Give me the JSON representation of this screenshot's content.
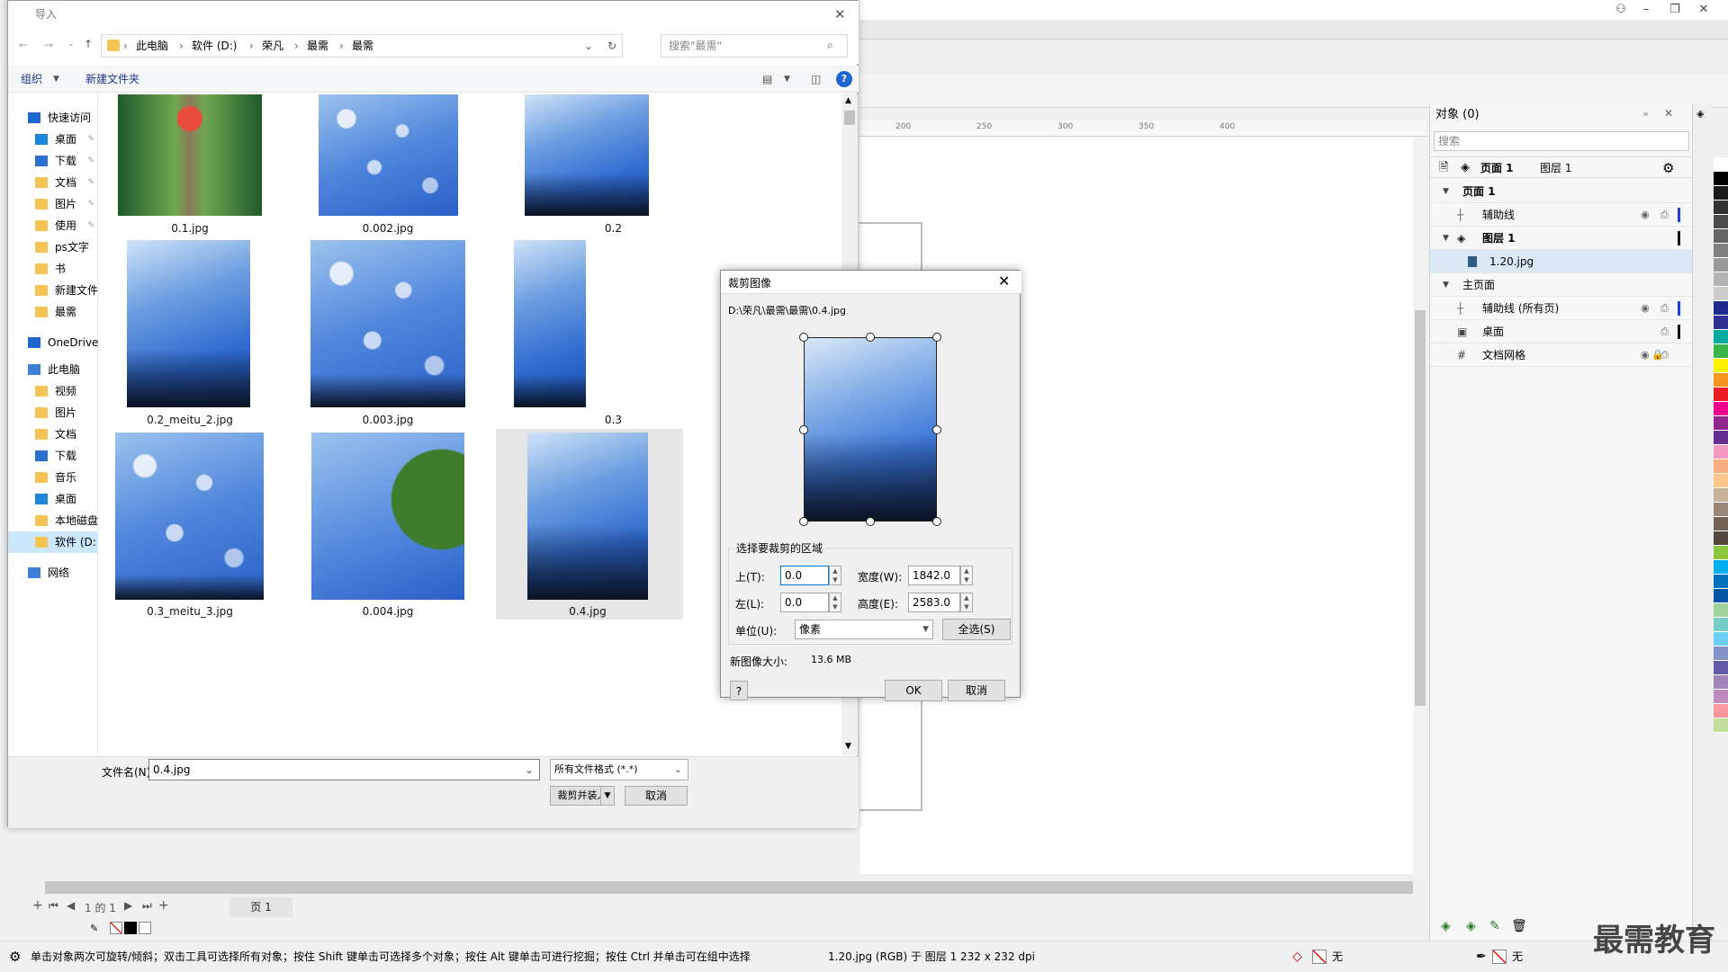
{
  "app": {
    "status_hint": "单击对象两次可旋转/倾斜；双击工具可选择所有对象；按住 Shift 键单击可选择多个对象；按住 Alt 键单击可进行挖掘；按住 Ctrl 并单击可在组中选择",
    "status_info": "1.20.jpg (RGB) 于 图层 1 232 x 232 dpi",
    "fill_none": "无",
    "outline_none": "无",
    "ruler_ticks": [
      "200",
      "250",
      "300",
      "350",
      "400"
    ],
    "page_of": "1 的 1",
    "page_tab": "页 1",
    "watermark": "最需教育"
  },
  "objects_panel": {
    "title": "对象 (0)",
    "search_placeholder": "搜索",
    "header_page": "页面 1",
    "header_layer": "图层 1",
    "rows": [
      {
        "label": "页面 1"
      },
      {
        "label": "辅助线"
      },
      {
        "label": "图层 1"
      },
      {
        "label": "1.20.jpg"
      },
      {
        "label": "主页面"
      },
      {
        "label": "辅助线 (所有页)"
      },
      {
        "label": "桌面"
      },
      {
        "label": "文档网格"
      }
    ]
  },
  "file_dialog": {
    "title": "导入",
    "breadcrumb": [
      "此电脑",
      "软件 (D:)",
      "荣凡",
      "最需",
      "最需"
    ],
    "search_placeholder": "搜索\"最需\"",
    "organize": "组织",
    "new_folder": "新建文件夹",
    "nav": [
      {
        "label": "快速访问",
        "pin": false
      },
      {
        "label": "桌面",
        "pin": true
      },
      {
        "label": "下载",
        "pin": true
      },
      {
        "label": "文档",
        "pin": true
      },
      {
        "label": "图片",
        "pin": true
      },
      {
        "label": "使用",
        "pin": true
      },
      {
        "label": "ps文字",
        "pin": false
      },
      {
        "label": "书",
        "pin": false
      },
      {
        "label": "新建文件",
        "pin": false
      },
      {
        "label": "最需",
        "pin": false
      },
      {
        "label": "OneDrive",
        "pin": false
      },
      {
        "label": "此电脑",
        "pin": false
      },
      {
        "label": "视频",
        "pin": false
      },
      {
        "label": "图片",
        "pin": false
      },
      {
        "label": "文档",
        "pin": false
      },
      {
        "label": "下载",
        "pin": false
      },
      {
        "label": "音乐",
        "pin": false
      },
      {
        "label": "桌面",
        "pin": false
      },
      {
        "label": "本地磁盘",
        "pin": false
      },
      {
        "label": "软件 (D:",
        "pin": false
      },
      {
        "label": "网络",
        "pin": false
      }
    ],
    "files": [
      "0.1.jpg",
      "0.002.jpg",
      "0.2",
      "0.2_meitu_2.jpg",
      "0.003.jpg",
      "0.3",
      "0.3_meitu_3.jpg",
      "0.004.jpg",
      "0.4.jpg"
    ],
    "filename_label": "文件名(N):",
    "filename_value": "0.4.jpg",
    "filetype_value": "所有文件格式 (*.*)",
    "import_button": "裁剪并装入",
    "cancel_button": "取消"
  },
  "crop_dialog": {
    "title": "裁剪图像",
    "path": "D:\\荣凡\\最需\\最需\\0.4.jpg",
    "group_label": "选择要裁剪的区域",
    "top_label": "上(T):",
    "top_value": "0.0",
    "left_label": "左(L):",
    "left_value": "0.0",
    "width_label": "宽度(W):",
    "width_value": "1842.0",
    "height_label": "高度(E):",
    "height_value": "2583.0",
    "unit_label": "单位(U):",
    "unit_value": "像素",
    "select_all": "全选(S)",
    "size_label": "新图像大小:",
    "size_value": "13.6 MB",
    "help": "?",
    "ok": "OK",
    "cancel": "取消"
  },
  "colors": {
    "accent_blue": "#0078d7",
    "palette": [
      "#ffffff",
      "#000000",
      "#1a1a1a",
      "#333333",
      "#4d4d4d",
      "#666666",
      "#808080",
      "#999999",
      "#b3b3b3",
      "#cccccc",
      "#1f2a8c",
      "#2e3192",
      "#00a99d",
      "#39b54a",
      "#fff200",
      "#f7941d",
      "#ed1c24",
      "#ec008c",
      "#92278f",
      "#662d91",
      "#f49ac1",
      "#f9ad81",
      "#fdc68a",
      "#c7b299",
      "#998675",
      "#736357",
      "#534741",
      "#8dc63f",
      "#00aeef",
      "#0072bc",
      "#0054a6",
      "#a3d39c",
      "#7accc8",
      "#6dcff6",
      "#8393ca",
      "#605ca8",
      "#a186be",
      "#bd8cbf",
      "#f6989d",
      "#c4df9b"
    ]
  }
}
